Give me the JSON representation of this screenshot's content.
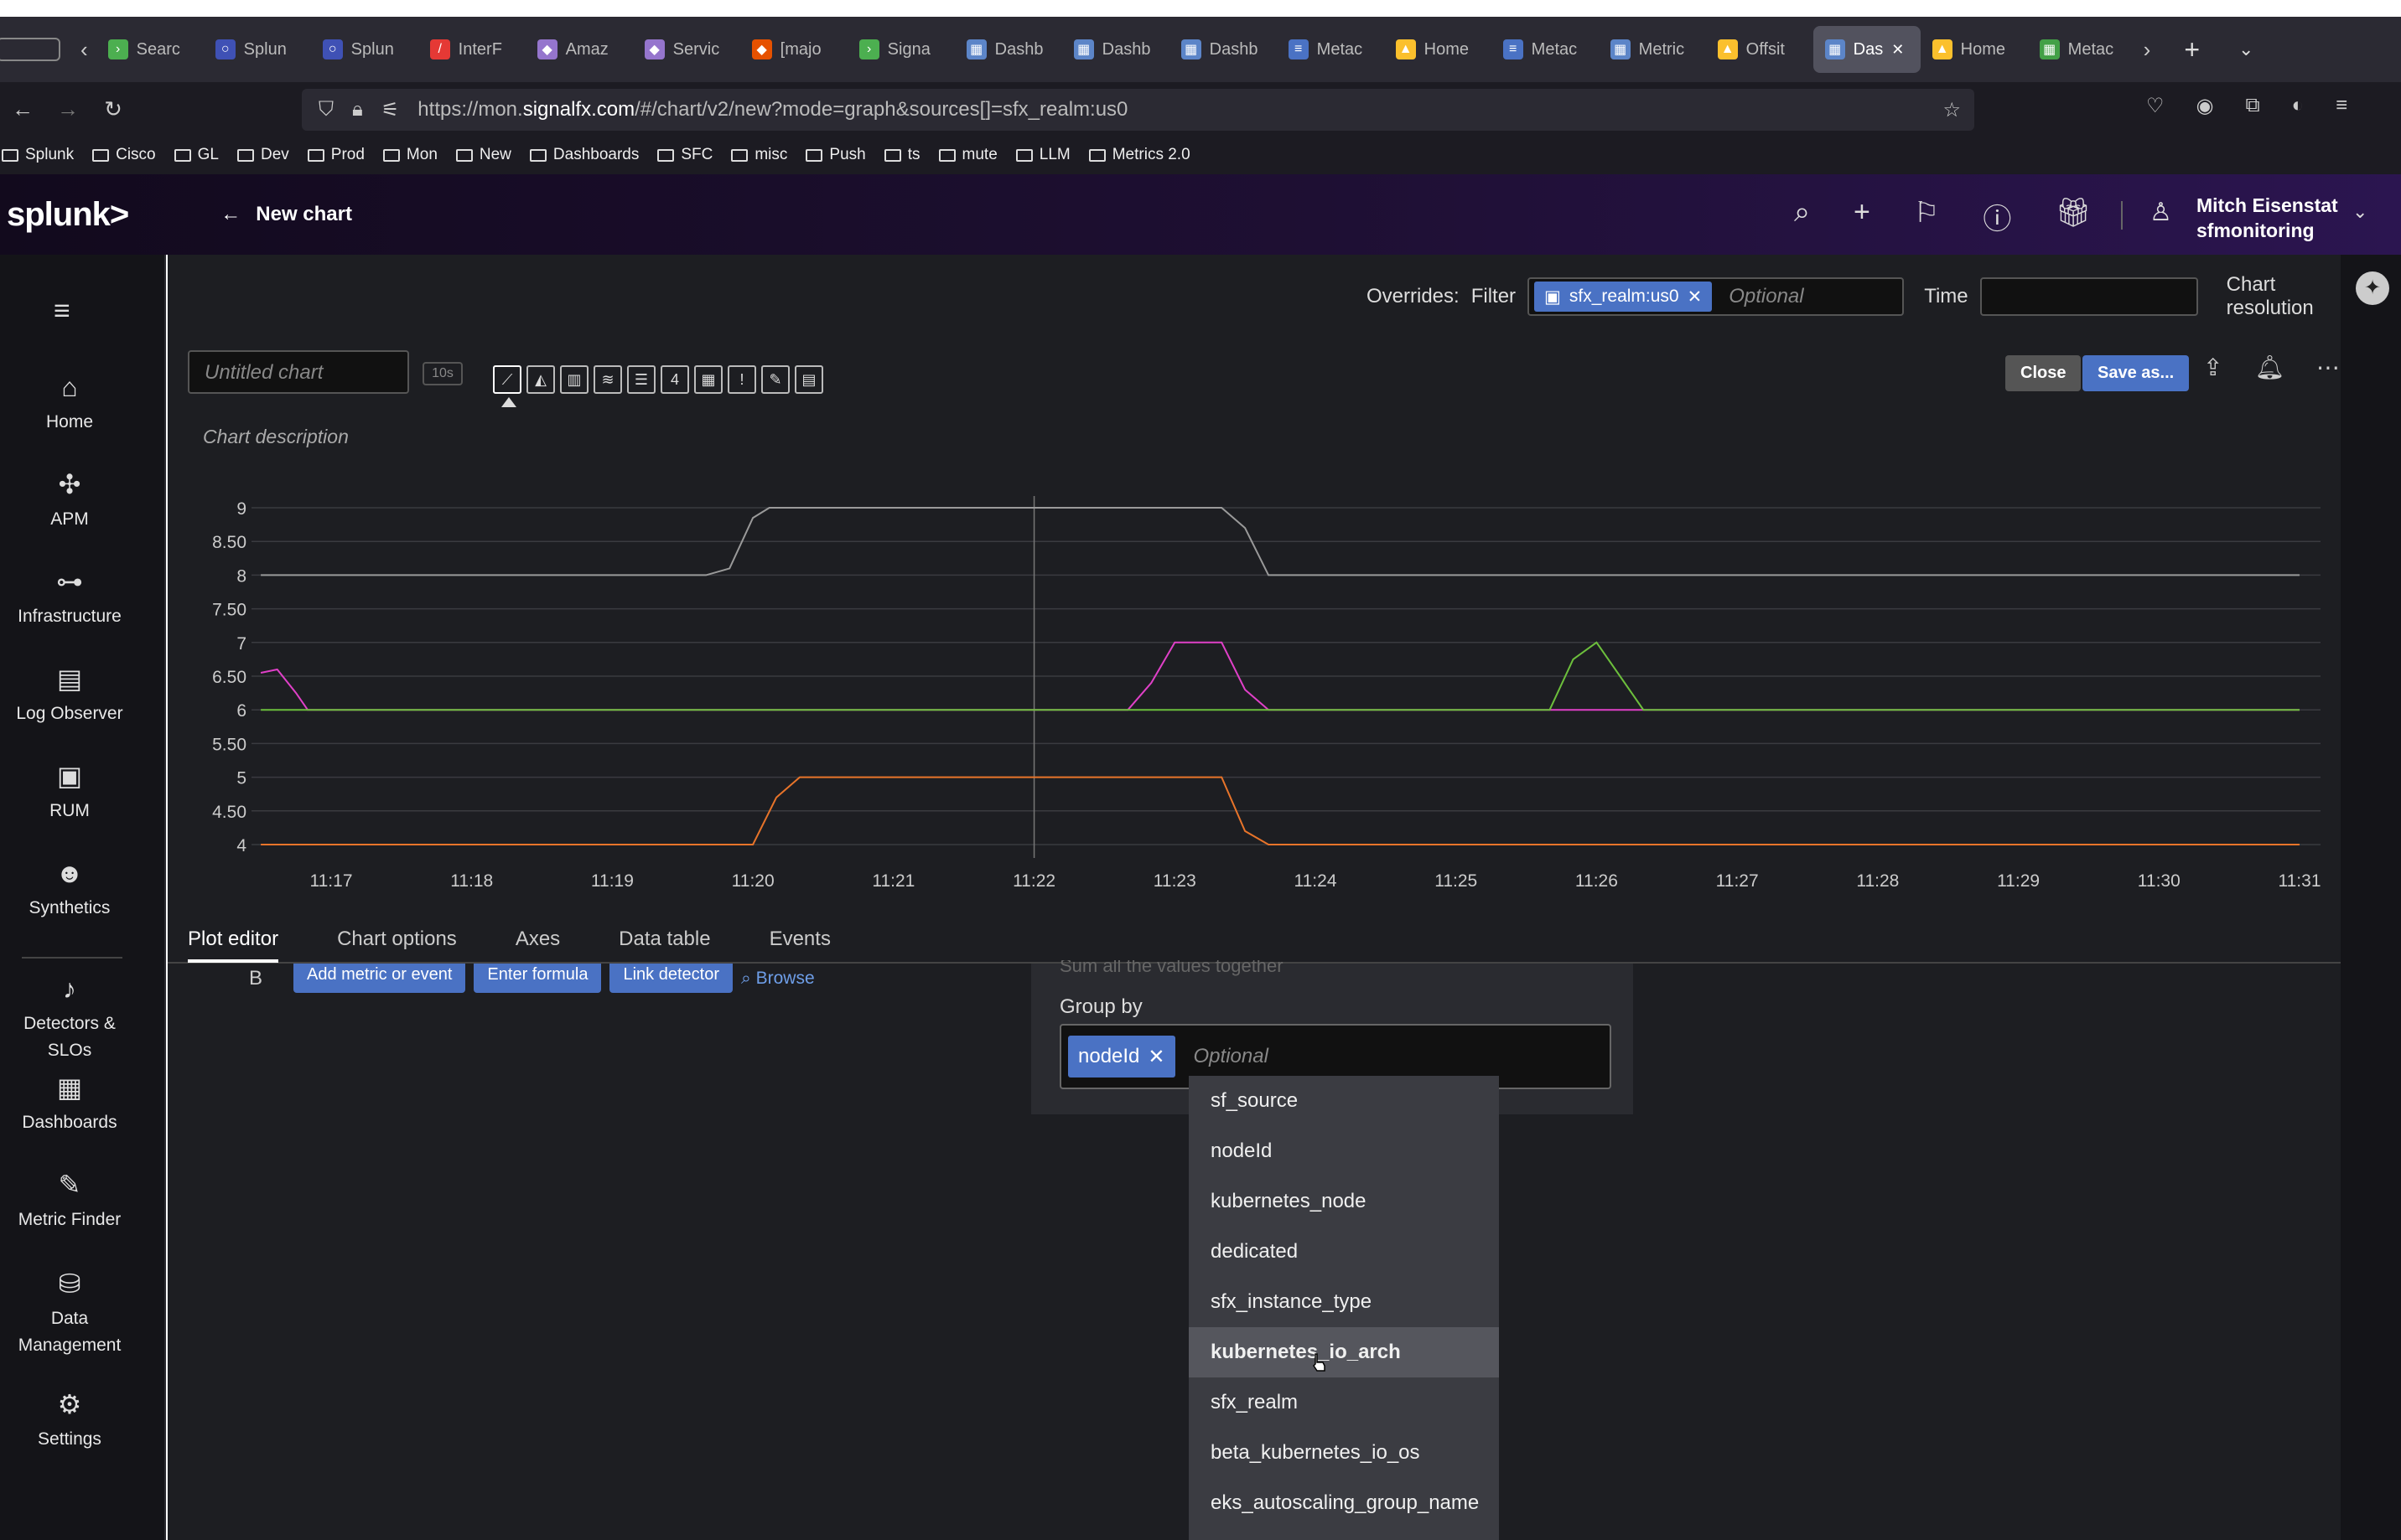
{
  "browser": {
    "tabs": [
      {
        "label": "Searc",
        "color": "#4caf50",
        "glyph": "›"
      },
      {
        "label": "Splun",
        "color": "#3f51b5",
        "glyph": "○"
      },
      {
        "label": "Splun",
        "color": "#3f51b5",
        "glyph": "○"
      },
      {
        "label": "InterF",
        "color": "#e53935",
        "glyph": "/"
      },
      {
        "label": "Amaz",
        "color": "#9575cd",
        "glyph": "◆"
      },
      {
        "label": "Servic",
        "color": "#9575cd",
        "glyph": "◆"
      },
      {
        "label": "[majo",
        "color": "#e65100",
        "glyph": "◆"
      },
      {
        "label": "Signa",
        "color": "#4caf50",
        "glyph": "›"
      },
      {
        "label": "Dashb",
        "color": "#5c85c8",
        "glyph": "▦"
      },
      {
        "label": "Dashb",
        "color": "#5c85c8",
        "glyph": "▦"
      },
      {
        "label": "Dashb",
        "color": "#5c85c8",
        "glyph": "▦"
      },
      {
        "label": "Metac",
        "color": "#4a72c4",
        "glyph": "≡"
      },
      {
        "label": "Home",
        "color": "#fbc02d",
        "glyph": "▲"
      },
      {
        "label": "Metac",
        "color": "#4a72c4",
        "glyph": "≡"
      },
      {
        "label": "Metric",
        "color": "#5c85c8",
        "glyph": "▦"
      },
      {
        "label": "Offsit",
        "color": "#fbc02d",
        "glyph": "▲"
      },
      {
        "label": "Das",
        "color": "#5c85c8",
        "glyph": "▦",
        "active": true
      },
      {
        "label": "Home",
        "color": "#fbc02d",
        "glyph": "▲"
      },
      {
        "label": "Metac",
        "color": "#43a047",
        "glyph": "▦"
      }
    ],
    "url_prefix": "https://mon.",
    "url_domain": "signalfx.com",
    "url_rest": "/#/chart/v2/new?mode=graph&sources[]=sfx_realm:us0",
    "bookmarks": [
      "Splunk",
      "Cisco",
      "GL",
      "Dev",
      "Prod",
      "Mon",
      "New",
      "Dashboards",
      "SFC",
      "misc",
      "Push",
      "ts",
      "mute",
      "LLM",
      "Metrics 2.0"
    ]
  },
  "header": {
    "logo": "splunk>",
    "back_label": "New chart",
    "user_name": "Mitch Eisenstat",
    "org_name": "sfmonitoring"
  },
  "nav": [
    {
      "label": "Home",
      "icon": "home-icon",
      "glyph": "⌂"
    },
    {
      "label": "APM",
      "icon": "apm-icon",
      "glyph": "✣"
    },
    {
      "label": "Infrastructure",
      "icon": "infrastructure-icon",
      "glyph": "⊶"
    },
    {
      "label": "Log Observer",
      "icon": "log-icon",
      "glyph": "▤"
    },
    {
      "label": "RUM",
      "icon": "rum-icon",
      "glyph": "▣"
    },
    {
      "label": "Synthetics",
      "icon": "robot-icon",
      "glyph": "☻"
    },
    {
      "label": "Detectors & SLOs",
      "icon": "bell-icon",
      "glyph": "♪"
    },
    {
      "label": "Dashboards",
      "icon": "dashboards-icon",
      "glyph": "▦"
    },
    {
      "label": "Metric Finder",
      "icon": "ruler-icon",
      "glyph": "✎"
    },
    {
      "label": "Data Management",
      "icon": "database-icon",
      "glyph": "⛁"
    },
    {
      "label": "Settings",
      "icon": "gear-icon",
      "glyph": "⚙"
    }
  ],
  "overrides": {
    "label": "Overrides:",
    "filter_label": "Filter",
    "filter_chip": "sfx_realm:us0",
    "filter_placeholder": "Optional",
    "time_label": "Time",
    "resolution_label": "Chart resolution"
  },
  "chart_header": {
    "title_placeholder": "Untitled chart",
    "resolution_badge": "10s",
    "close_label": "Close",
    "save_label": "Save as...",
    "description": "Chart description"
  },
  "chart_data": {
    "type": "line",
    "x": [
      "11:16:30",
      "11:17",
      "11:18",
      "11:19",
      "11:19:40",
      "11:20",
      "11:20:20",
      "11:21",
      "11:22",
      "11:23",
      "11:23:20",
      "11:23:40",
      "11:24",
      "11:25",
      "11:25:40",
      "11:26",
      "11:26:20",
      "11:26:40",
      "11:27",
      "11:28",
      "11:29",
      "11:30",
      "11:31"
    ],
    "xticks": [
      "11:17",
      "11:18",
      "11:19",
      "11:20",
      "11:21",
      "11:22",
      "11:23",
      "11:24",
      "11:25",
      "11:26",
      "11:27",
      "11:28",
      "11:29",
      "11:30",
      "11:31"
    ],
    "ylim": [
      4,
      9
    ],
    "yticks": [
      "4",
      "4.50",
      "5",
      "5.50",
      "6",
      "6.50",
      "7",
      "7.50",
      "8",
      "8.50",
      "9"
    ],
    "crosshair_x": "11:22",
    "series": [
      {
        "color": "#9a9a9a",
        "points": [
          [
            "11:16:30",
            8
          ],
          [
            "11:19:40",
            8
          ],
          [
            "11:19:50",
            8.1
          ],
          [
            "11:20",
            8.85
          ],
          [
            "11:20:07",
            9
          ],
          [
            "11:23:20",
            9
          ],
          [
            "11:23:30",
            8.7
          ],
          [
            "11:23:40",
            8
          ],
          [
            "11:31",
            8
          ]
        ]
      },
      {
        "color": "#e040c8",
        "points": [
          [
            "11:16:30",
            6.55
          ],
          [
            "11:16:37",
            6.6
          ],
          [
            "11:16:45",
            6.25
          ],
          [
            "11:16:50",
            6
          ],
          [
            "11:22:40",
            6
          ],
          [
            "11:22:50",
            6.4
          ],
          [
            "11:23",
            7
          ],
          [
            "11:23:20",
            7
          ],
          [
            "11:23:30",
            6.3
          ],
          [
            "11:23:40",
            6
          ],
          [
            "11:31",
            6
          ]
        ]
      },
      {
        "color": "#6cbf3c",
        "points": [
          [
            "11:16:30",
            6
          ],
          [
            "11:25:40",
            6
          ],
          [
            "11:25:50",
            6.75
          ],
          [
            "11:26",
            7
          ],
          [
            "11:26:10",
            6.5
          ],
          [
            "11:26:20",
            6
          ],
          [
            "11:31",
            6
          ]
        ]
      },
      {
        "color": "#e8742a",
        "points": [
          [
            "11:16:30",
            4
          ],
          [
            "11:20",
            4
          ],
          [
            "11:20:10",
            4.7
          ],
          [
            "11:20:20",
            5
          ],
          [
            "11:23:20",
            5
          ],
          [
            "11:23:30",
            4.2
          ],
          [
            "11:23:40",
            4
          ],
          [
            "11:31",
            4
          ]
        ]
      }
    ]
  },
  "tabs": [
    "Plot editor",
    "Chart options",
    "Axes",
    "Data table",
    "Events"
  ],
  "plot_editor": {
    "row_label": "B",
    "buttons": [
      "Add metric or event",
      "Enter formula",
      "Link detector"
    ],
    "browse": "Browse"
  },
  "group_by": {
    "cut_text": "Sum all the values together",
    "label": "Group by",
    "chip": "nodeId",
    "placeholder": "Optional",
    "options": [
      "sf_source",
      "nodeId",
      "kubernetes_node",
      "dedicated",
      "sfx_instance_type",
      "kubernetes_io_arch",
      "sfx_realm",
      "beta_kubernetes_io_os",
      "eks_autoscaling_group_name"
    ],
    "highlighted_index": 5
  }
}
